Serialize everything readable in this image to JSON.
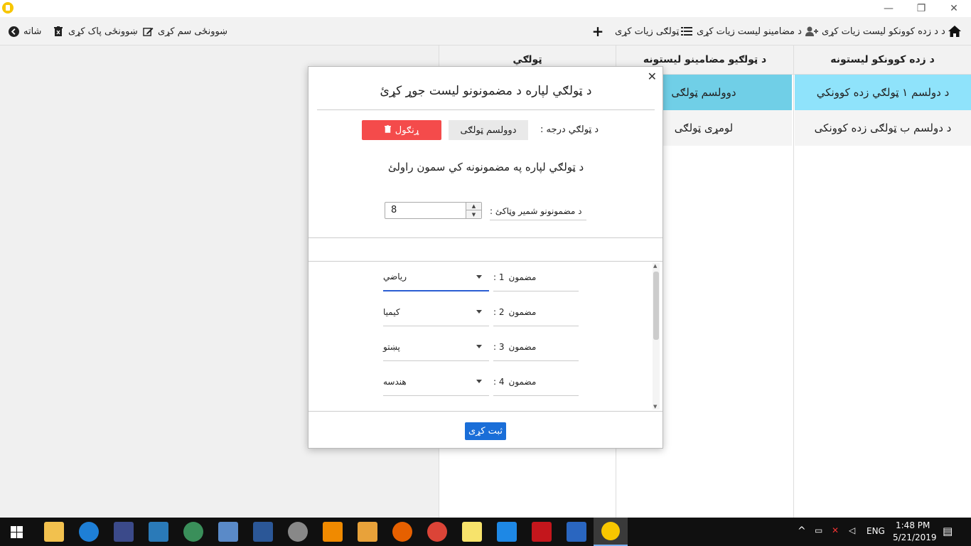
{
  "window": {
    "minimize_glyph": "—",
    "maximize_glyph": "❐",
    "close_glyph": "✕"
  },
  "toolbar": {
    "back_label": "شاته",
    "delete_schedule_label": "ښوونځی پاک کړی",
    "edit_schedule_label": "ښوونځی سم کړی",
    "add_class_label": "ټولګی زیات کړی",
    "add_subject_list_label": "د مضامینو لیست زیات کړی",
    "add_students_label": "د د زده کوونکو لیست زیات کړی"
  },
  "columns": {
    "students_header": "د زده کوونکو لیستونه",
    "subjects_header": "د ټولګیو مضامینو لیستونه",
    "class_header": "ټولګي"
  },
  "students_list": [
    "د دولسم ۱ ټولګي زده کوونکي",
    "د دولسم ب ټولګی زده کوونکی"
  ],
  "subjects_list": [
    "دوولسم ټولګی",
    "لومړی ټولګی"
  ],
  "dialog": {
    "close_glyph": "✕",
    "title": "د ټولګي لپاره د مضمونونو لیست جوړ کړئ",
    "class_grade_label": "د ټولګي درجه :",
    "class_grade_value": "دوولسم ټولګی",
    "delete_label": "ړنګول",
    "subtitle": "د ټولګي لپاره په مضمونونه کي سمون راولئ",
    "subject_count_label": "د مضمونونو شمیر وټاکئ :",
    "subject_count_value": "8",
    "subject_word": "مضمون",
    "subjects": [
      {
        "number": "1 :",
        "value": "ریاضي"
      },
      {
        "number": "2 :",
        "value": "کیمیا"
      },
      {
        "number": "3 :",
        "value": "پښتو"
      },
      {
        "number": "4 :",
        "value": "هندسه"
      }
    ],
    "save_label": "ثبت کړی"
  },
  "taskbar": {
    "time": "1:48 PM",
    "date": "5/21/2019",
    "language": "ENG"
  },
  "colors": {
    "accent_blue": "#1a6ed8",
    "selected_row": "#8fe3fb",
    "selected_row_dark": "#70cfe7",
    "delete_red": "#f44b4b"
  }
}
